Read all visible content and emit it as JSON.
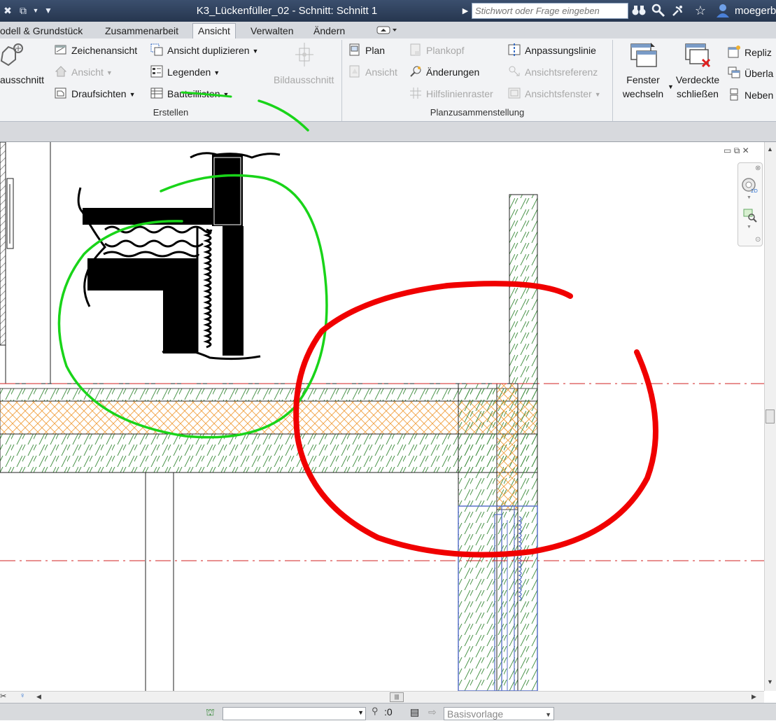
{
  "window": {
    "title": "K3_Lückenfüller_02 - Schnitt: Schnitt 1",
    "search_placeholder": "Stichwort oder Frage eingeben",
    "user": "moegerb"
  },
  "tabs": [
    {
      "label": "odell & Grundstück",
      "active": false
    },
    {
      "label": "Zusammenarbeit",
      "active": false
    },
    {
      "label": "Ansicht",
      "active": true
    },
    {
      "label": "Verwalten",
      "active": false
    },
    {
      "label": "Ändern",
      "active": false
    }
  ],
  "ribbon": {
    "erstellen": {
      "label": "Erstellen",
      "detail_cut": "ausschnitt",
      "items": {
        "zeichenansicht": "Zeichenansicht",
        "ansicht": "Ansicht",
        "draufsichten": "Draufsichten",
        "ansicht_duplizieren": "Ansicht duplizieren",
        "legenden": "Legenden",
        "bauteillisten": "Bauteillisten",
        "bildausschnitt": "Bildausschnitt"
      }
    },
    "planzusammenstellung": {
      "label": "Planzusammenstellung",
      "items": {
        "plan": "Plan",
        "ansicht": "Ansicht",
        "plankopf": "Plankopf",
        "aenderungen": "Änderungen",
        "hilfslinienraster": "Hilfslinienraster",
        "anpassungslinie": "Anpassungslinie",
        "ansichtsreferenz": "Ansichtsreferenz",
        "ansichtsfenster": "Ansichtsfenster"
      }
    },
    "fenster": {
      "fenster_wechseln_1": "Fenster",
      "fenster_wechseln_2": "wechseln",
      "verdeckte_1": "Verdeckte",
      "verdeckte_2": "schließen",
      "replizieren": "Repliz",
      "ueberlappend": "Überla",
      "nebeneinander": "Neben"
    }
  },
  "statusbar": {
    "filter_count": ":0",
    "template": "Basisvorlage"
  },
  "colors": {
    "green_annotation": "#19d419",
    "red_annotation": "#f00000",
    "section_line": "#d22020",
    "hatch_green": "#3a8a3a",
    "hatch_orange": "#f0a040",
    "blue_selection": "#5870c8"
  }
}
